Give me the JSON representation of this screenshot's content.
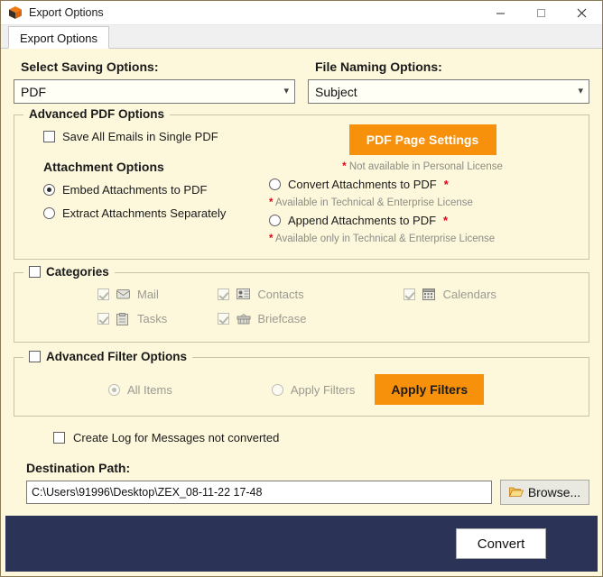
{
  "window": {
    "title": "Export Options",
    "icon": "app-box-icon",
    "controls": {
      "minimize": "minimize",
      "maximize": "maximize",
      "close": "close"
    }
  },
  "tabs": [
    {
      "label": "Export Options",
      "active": true
    }
  ],
  "saving": {
    "label": "Select Saving Options:",
    "value": "PDF"
  },
  "naming": {
    "label": "File Naming Options:",
    "value": "Subject"
  },
  "advanced_pdf": {
    "legend": "Advanced PDF Options",
    "save_single": {
      "label": "Save All Emails in Single PDF",
      "checked": false
    },
    "attachment_heading": "Attachment Options",
    "embed": {
      "label": "Embed Attachments to PDF",
      "selected": true
    },
    "extract": {
      "label": "Extract Attachments Separately",
      "selected": false
    },
    "page_settings_button": "PDF Page Settings",
    "note_personal": "Not available in Personal License",
    "convert_att": {
      "label": "Convert Attachments to PDF",
      "selected": false
    },
    "note_convert": "Available in Technical & Enterprise License",
    "append_att": {
      "label": "Append Attachments to PDF",
      "selected": false
    },
    "note_append": "Available only in Technical & Enterprise License",
    "star": "*"
  },
  "categories": {
    "legend": "Categories",
    "checked": false,
    "items": [
      {
        "label": "Mail",
        "icon": "mail-icon",
        "checked": true,
        "disabled": true
      },
      {
        "label": "Contacts",
        "icon": "contacts-icon",
        "checked": true,
        "disabled": true
      },
      {
        "label": "Calendars",
        "icon": "calendar-icon",
        "checked": true,
        "disabled": true
      },
      {
        "label": "Tasks",
        "icon": "tasks-icon",
        "checked": true,
        "disabled": true
      },
      {
        "label": "Briefcase",
        "icon": "briefcase-icon",
        "checked": true,
        "disabled": true
      }
    ]
  },
  "filters": {
    "legend": "Advanced Filter Options",
    "checked": false,
    "all_items": {
      "label": "All Items",
      "selected": true,
      "disabled": true
    },
    "apply_filters_radio": {
      "label": "Apply Filters",
      "selected": false,
      "disabled": true
    },
    "apply_filters_button": "Apply Filters"
  },
  "log": {
    "label": "Create Log for Messages not converted",
    "checked": false
  },
  "destination": {
    "label": "Destination Path:",
    "value": "C:\\Users\\91996\\Desktop\\ZEX_08-11-22 17-48",
    "browse_button": "Browse...",
    "browse_icon": "folder-open-icon"
  },
  "footer": {
    "convert_button": "Convert"
  },
  "colors": {
    "accent_orange": "#f7900b",
    "footer_navy": "#2b3356",
    "page_bg": "#fdf8dc",
    "note_gray": "#8c8c84",
    "star_red": "#e2001a"
  }
}
